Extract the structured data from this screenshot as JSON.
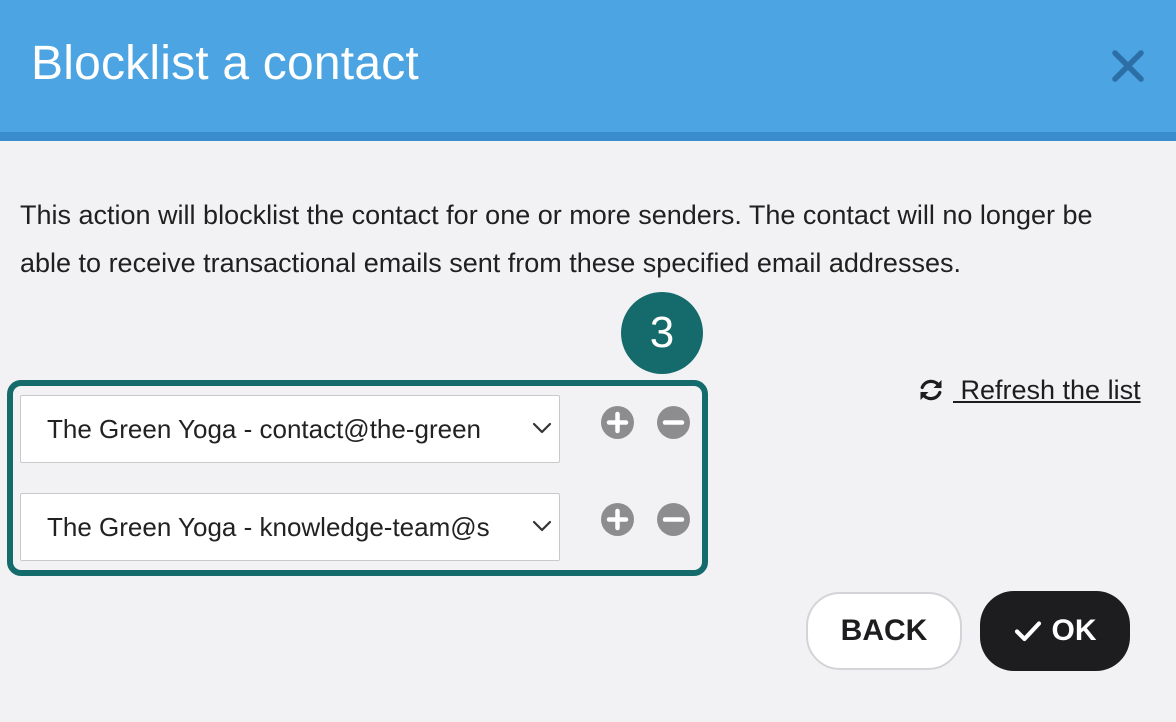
{
  "dialog": {
    "title": "Blocklist a contact",
    "description": "This action will blocklist the contact for one or more senders. The contact will no longer be able to receive transactional emails sent from these specified email addresses."
  },
  "step_badge": "3",
  "senders": [
    {
      "value": "The Green Yoga - contact@the-green"
    },
    {
      "value": "The Green Yoga - knowledge-team@s"
    }
  ],
  "refresh_label": " Refresh the list",
  "buttons": {
    "back": "BACK",
    "ok": "OK"
  },
  "icons": {
    "close": "close-icon",
    "chevron": "chevron-down-icon",
    "add": "plus-circle-icon",
    "remove": "minus-circle-icon",
    "refresh": "refresh-icon",
    "check": "check-icon"
  },
  "colors": {
    "header": "#4ca4e2",
    "highlight": "#156b6b",
    "ok_button": "#1d1d1f"
  }
}
